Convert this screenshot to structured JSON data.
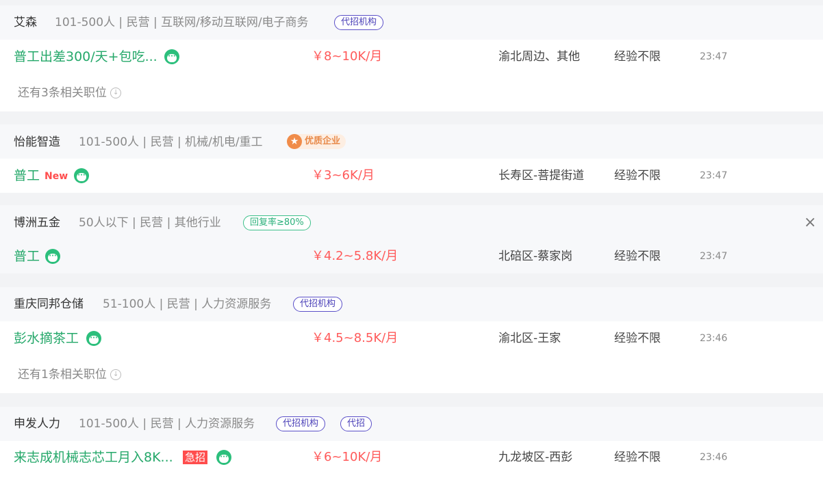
{
  "listings": [
    {
      "company": "艾森",
      "meta": "101-500人 | 民营 | 互联网/移动互联网/电子商务",
      "tags": [
        "代招机构"
      ],
      "job_title": "普工出差300/天+包吃...",
      "salary": "￥8~10K/月",
      "location": "渝北周边、其他",
      "experience": "经验不限",
      "time": "23:47",
      "more_text": "还有3条相关职位"
    },
    {
      "company": "怡能智造",
      "meta": "101-500人 | 民营 | 机械/机电/重工",
      "quality_tag": "优质企业",
      "job_title": "普工",
      "new_label": "New",
      "salary": "￥3~6K/月",
      "location": "长寿区-菩提街道",
      "experience": "经验不限",
      "time": "23:47"
    },
    {
      "company": "博洲五金",
      "meta": "50人以下 | 民营 | 其他行业",
      "reply_tag": "回复率≥80%",
      "job_title": "普工",
      "salary": "￥4.2~5.8K/月",
      "location": "北碚区-蔡家岗",
      "experience": "经验不限",
      "time": "23:47",
      "close_icon": "×"
    },
    {
      "company": "重庆同邦仓储",
      "meta": "51-100人 | 民营 | 人力资源服务",
      "tags": [
        "代招机构"
      ],
      "job_title": "彭水摘茶工",
      "salary": "￥4.5~8.5K/月",
      "location": "渝北区-王家",
      "experience": "经验不限",
      "time": "23:46",
      "more_text": "还有1条相关职位"
    },
    {
      "company": "申发人力",
      "meta": "101-500人 | 民营 | 人力资源服务",
      "tags": [
        "代招机构",
        "代招"
      ],
      "job_title": "来志成机械志芯工月入8K...",
      "urgent_label": "急招",
      "salary": "￥6~10K/月",
      "location": "九龙坡区-西彭",
      "experience": "经验不限",
      "time": "23:46"
    }
  ],
  "icons": {
    "chat": "chat-bubble-icon",
    "expand": "circle-arrow-down-icon",
    "star": "star-badge-icon",
    "close": "close-icon"
  },
  "colors": {
    "job_title": "#25a86a",
    "salary": "#ff5a5a",
    "agency_tag": "#4b41b8",
    "reply_tag": "#2bb07a",
    "quality_tag": "#e88a4a",
    "urgent": "#ff4d4d"
  }
}
